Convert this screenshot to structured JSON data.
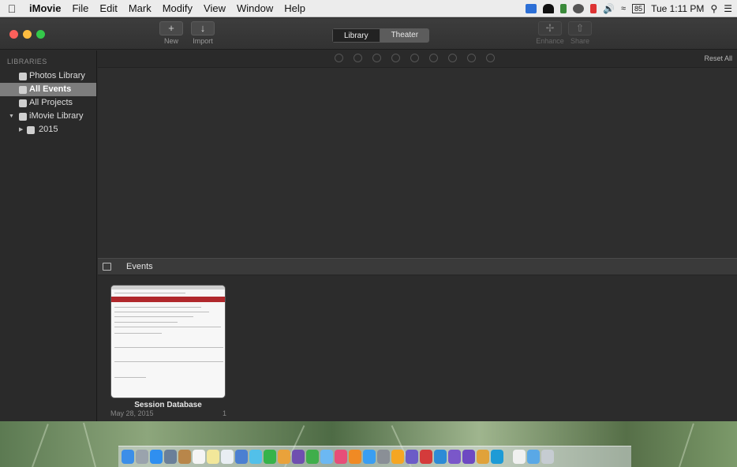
{
  "menubar": {
    "app": "iMovie",
    "menus": [
      "File",
      "Edit",
      "Mark",
      "Modify",
      "View",
      "Window",
      "Help"
    ],
    "clock": "Tue 1:11 PM",
    "battery_label": "85"
  },
  "toolbar": {
    "new_label": "New",
    "import_label": "Import",
    "library_label": "Library",
    "theater_label": "Theater",
    "enhance_label": "Enhance",
    "share_label": "Share"
  },
  "sidebar": {
    "header": "LIBRARIES",
    "items": [
      {
        "label": "Photos Library"
      },
      {
        "label": "All Events",
        "selected": true
      },
      {
        "label": "All Projects"
      },
      {
        "label": "iMovie Library"
      },
      {
        "label": "2015"
      }
    ]
  },
  "viewer": {
    "reset_label": "Reset All"
  },
  "events": {
    "title": "Events",
    "clips": [
      {
        "title": "Session Database",
        "date": "May 28, 2015",
        "count": "1"
      }
    ]
  },
  "colors": {
    "accent_red": "#b0282c",
    "selection": "#7d7d7d"
  }
}
